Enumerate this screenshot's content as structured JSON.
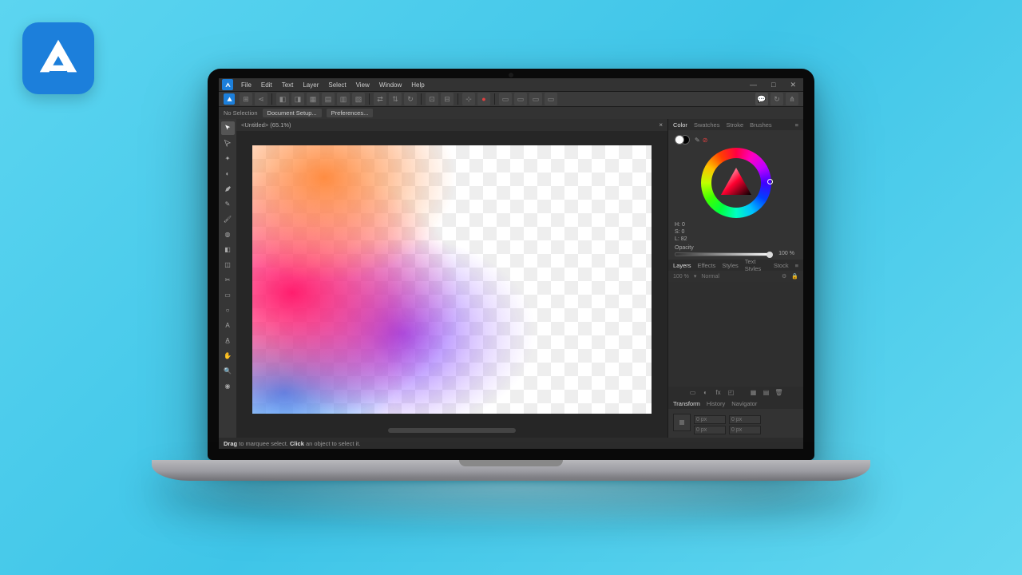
{
  "menubar": {
    "items": [
      "File",
      "Edit",
      "Text",
      "Layer",
      "Select",
      "View",
      "Window",
      "Help"
    ]
  },
  "window": {
    "min": "—",
    "max": "□",
    "close": "✕"
  },
  "context": {
    "status": "No Selection",
    "docsetup": "Document Setup...",
    "prefs": "Preferences..."
  },
  "tab": {
    "title": "<Untitled> (65.1%)",
    "close": "×"
  },
  "colorPanel": {
    "tabs": [
      "Color",
      "Swatches",
      "Stroke",
      "Brushes"
    ],
    "hsl": {
      "h": "H: 0",
      "s": "S: 0",
      "l": "L: 82"
    },
    "opacityLabel": "Opacity",
    "opacityValue": "100 %"
  },
  "layersPanel": {
    "tabs": [
      "Layers",
      "Effects",
      "Styles",
      "Text Styles",
      "Stock"
    ],
    "opacity": "100 %",
    "blend": "Normal"
  },
  "transformPanel": {
    "tabs": [
      "Transform",
      "History",
      "Navigator"
    ],
    "x": "0 px",
    "y": "0 px",
    "w": "0 px",
    "h": "0 px"
  },
  "status": {
    "drag": "Drag",
    "dragText": " to marquee select. ",
    "click": "Click",
    "clickText": " an object to select it."
  },
  "tools": [
    "move",
    "node",
    "point",
    "pen",
    "pencil",
    "brush",
    "fill",
    "gradient",
    "transparency",
    "shape",
    "rect",
    "ellipse",
    "text",
    "crop",
    "hand",
    "zoom",
    "text2",
    "color"
  ]
}
